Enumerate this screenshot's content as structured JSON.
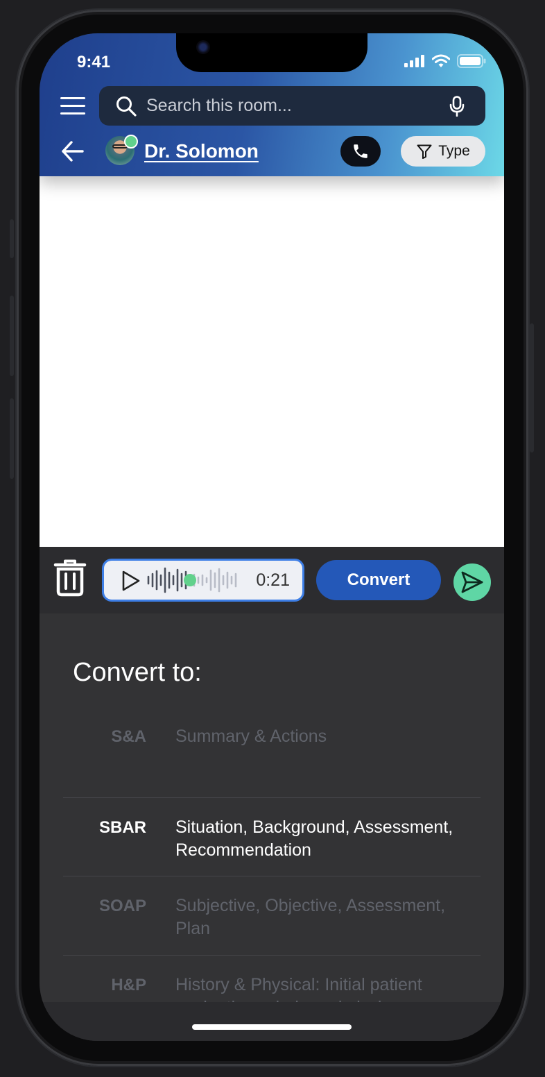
{
  "status_bar": {
    "time": "9:41"
  },
  "header": {
    "search_placeholder": "Search this room...",
    "contact_name": "Dr. Solomon",
    "type_filter_label": "Type"
  },
  "recorder": {
    "duration": "0:21",
    "convert_label": "Convert"
  },
  "convert_sheet": {
    "title": "Convert to:",
    "options": [
      {
        "code": "S&A",
        "description": "Summary & Actions",
        "selected": false
      },
      {
        "code": "SBAR",
        "description": "Situation, Background, Assessment, Recommendation",
        "selected": true
      },
      {
        "code": "SOAP",
        "description": "Subjective, Objective, Assessment, Plan",
        "selected": false
      },
      {
        "code": "H&P",
        "description": "History & Physical: Initial patient evaluation - during admission.",
        "selected": false
      }
    ]
  },
  "colors": {
    "accent_blue": "#2458b8",
    "send_green": "#5fd6a5",
    "online_green": "#61d18c"
  }
}
